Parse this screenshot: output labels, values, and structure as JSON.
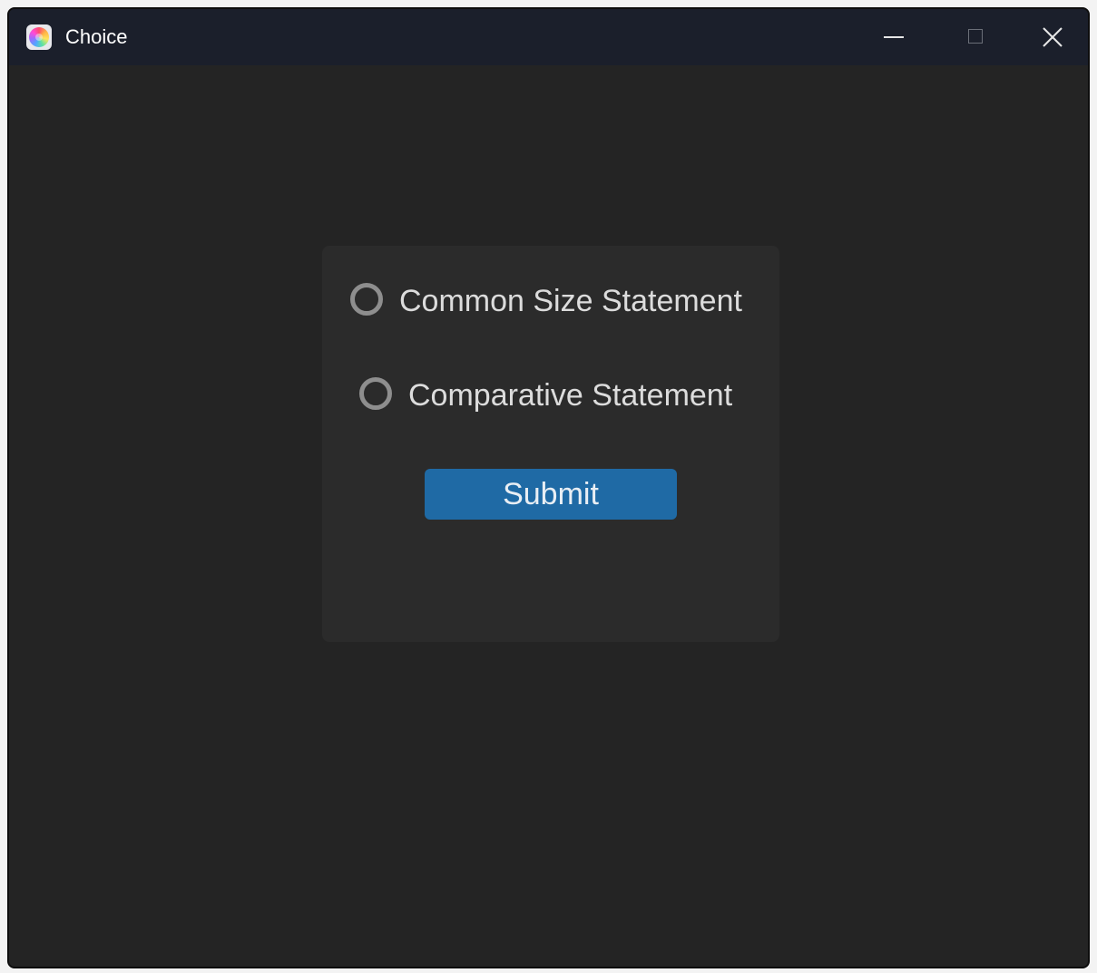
{
  "window": {
    "title": "Choice",
    "app_icon": "colorful-app-icon",
    "controls": {
      "minimize_icon": "minimize-icon",
      "maximize_icon": "maximize-icon",
      "close_icon": "close-icon"
    }
  },
  "form": {
    "options": [
      {
        "label": "Common Size Statement",
        "selected": false
      },
      {
        "label": "Comparative Statement",
        "selected": false
      }
    ],
    "submit_label": "Submit"
  },
  "colors": {
    "window_background": "#242424",
    "titlebar_background": "#1b1f2b",
    "card_background": "#2b2b2b",
    "button_accent": "#1f6aa5",
    "radio_border": "#8e8e8e",
    "text": "#dcdcdc"
  }
}
